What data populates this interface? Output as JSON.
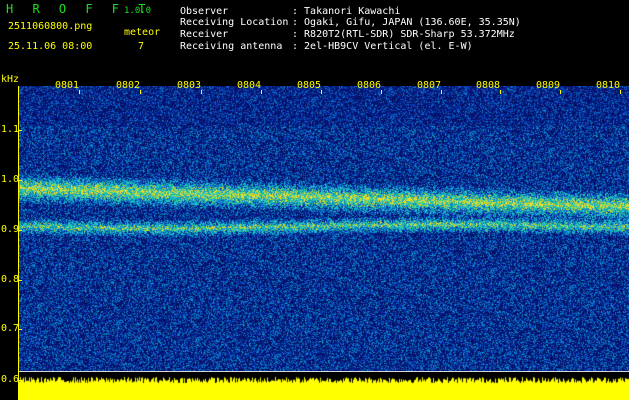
{
  "header": {
    "app_title": "H R O F F T",
    "version": "1.0.0",
    "filename": "2511060800.png",
    "datetime": "25.11.06 08:00",
    "meteor_label": "meteor",
    "meteor_count": "7",
    "observer_label": "Observer",
    "observer_value": ": Takanori Kawachi",
    "location_label": "Receiving Location",
    "location_value": ": Ogaki, Gifu, JAPAN (136.60E, 35.35N)",
    "receiver_label": "Receiver",
    "receiver_value": ": R820T2(RTL-SDR) SDR-Sharp 53.372MHz",
    "antenna_label": "Receiving antenna",
    "antenna_value": ": 2el-HB9CV Vertical (el. E-W)"
  },
  "axes": {
    "y_unit": "kHz",
    "y_ticks": [
      "1.1",
      "1.0",
      "0.9",
      "0.8",
      "0.7",
      "0.6"
    ],
    "x_ticks": [
      "0801",
      "0802",
      "0803",
      "0804",
      "0805",
      "0806",
      "0807",
      "0808",
      "0809",
      "0810"
    ]
  },
  "colors": {
    "label_yellow": "#ffff00",
    "title_green": "#1de01d",
    "spectrum_bg": "#0a0f6e",
    "level_fill": "#ffff00"
  }
}
